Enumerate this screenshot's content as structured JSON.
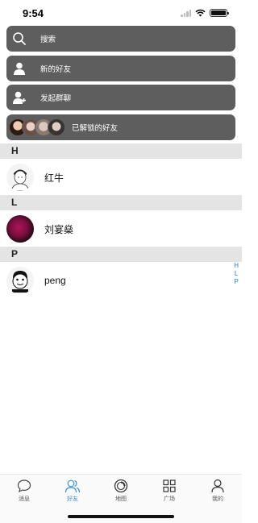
{
  "status_bar": {
    "time": "9:54"
  },
  "menu": {
    "search_label": "搜索",
    "new_friends_label": "新的好友",
    "start_group_label": "发起群聊",
    "unlocked_friends_label": "已解锁的好友"
  },
  "sections": [
    {
      "letter": "H",
      "contacts": [
        {
          "name": "红牛"
        }
      ]
    },
    {
      "letter": "L",
      "contacts": [
        {
          "name": "刘宴燊"
        }
      ]
    },
    {
      "letter": "P",
      "contacts": [
        {
          "name": "peng"
        }
      ]
    }
  ],
  "index_letters": [
    "H",
    "L",
    "P"
  ],
  "tabs": [
    {
      "label": "消息",
      "icon": "chat-bubble-icon"
    },
    {
      "label": "好友",
      "icon": "friends-icon",
      "active": true
    },
    {
      "label": "地图",
      "icon": "map-circle-icon"
    },
    {
      "label": "广场",
      "icon": "grid-icon"
    },
    {
      "label": "我的",
      "icon": "person-icon"
    }
  ],
  "colors": {
    "menu_bg": "#5e5e5e",
    "accent": "#3a93d8",
    "index": "#1a7fe0",
    "section_bg": "#e4e4e4"
  }
}
